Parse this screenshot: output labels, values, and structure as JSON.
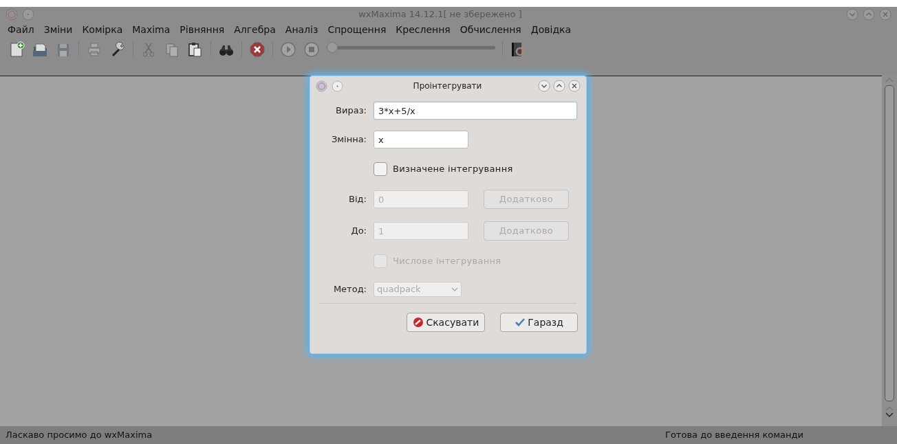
{
  "window": {
    "title": "wxMaxima 14.12.1[ не збережено ]"
  },
  "menu": [
    {
      "label": "Файл"
    },
    {
      "label": "Зміни"
    },
    {
      "label": "Комірка"
    },
    {
      "label": "Maxima"
    },
    {
      "label": "Рівняння"
    },
    {
      "label": "Алгебра"
    },
    {
      "label": "Аналіз"
    },
    {
      "label": "Спрощення"
    },
    {
      "label": "Креслення"
    },
    {
      "label": "Обчислення"
    },
    {
      "label": "Довідка"
    }
  ],
  "toolbar": [
    {
      "kind": "new",
      "disabled": false
    },
    {
      "kind": "open",
      "disabled": false
    },
    {
      "kind": "save",
      "disabled": true
    },
    {
      "kind": "sep"
    },
    {
      "kind": "print",
      "disabled": true
    },
    {
      "kind": "wrench",
      "disabled": false
    },
    {
      "kind": "sep"
    },
    {
      "kind": "cut",
      "disabled": true
    },
    {
      "kind": "copy",
      "disabled": true
    },
    {
      "kind": "paste",
      "disabled": false
    },
    {
      "kind": "sep"
    },
    {
      "kind": "find",
      "disabled": false
    },
    {
      "kind": "sep"
    },
    {
      "kind": "interrupt",
      "disabled": false
    },
    {
      "kind": "sep"
    },
    {
      "kind": "play",
      "disabled": true
    },
    {
      "kind": "stop",
      "disabled": true
    },
    {
      "kind": "slider",
      "level": 0
    },
    {
      "kind": "sep"
    },
    {
      "kind": "help",
      "disabled": false
    }
  ],
  "dialog": {
    "title": "Проінтегрувати",
    "expression": {
      "label": "Вираз:",
      "value": "3*x+5/x"
    },
    "variable": {
      "label": "Змінна:",
      "value": "x"
    },
    "definite": {
      "label": "Визначене інтегрування",
      "checked": false,
      "disabled": false
    },
    "from": {
      "label": "Від:",
      "value": "0",
      "disabled": true,
      "button": "Додатково"
    },
    "to": {
      "label": "До:",
      "value": "1",
      "disabled": true,
      "button": "Додатково"
    },
    "numeric": {
      "label": "Числове інтегрування",
      "checked": false,
      "disabled": true
    },
    "method": {
      "label": "Метод:",
      "value": "quadpack",
      "disabled": true
    },
    "cancel": {
      "label": "Скасувати"
    },
    "ok": {
      "label": "Гаразд"
    }
  },
  "status_bar": {
    "left": "Ласкаво просимо до wxMaxima",
    "right": "Готова до введення команди"
  }
}
